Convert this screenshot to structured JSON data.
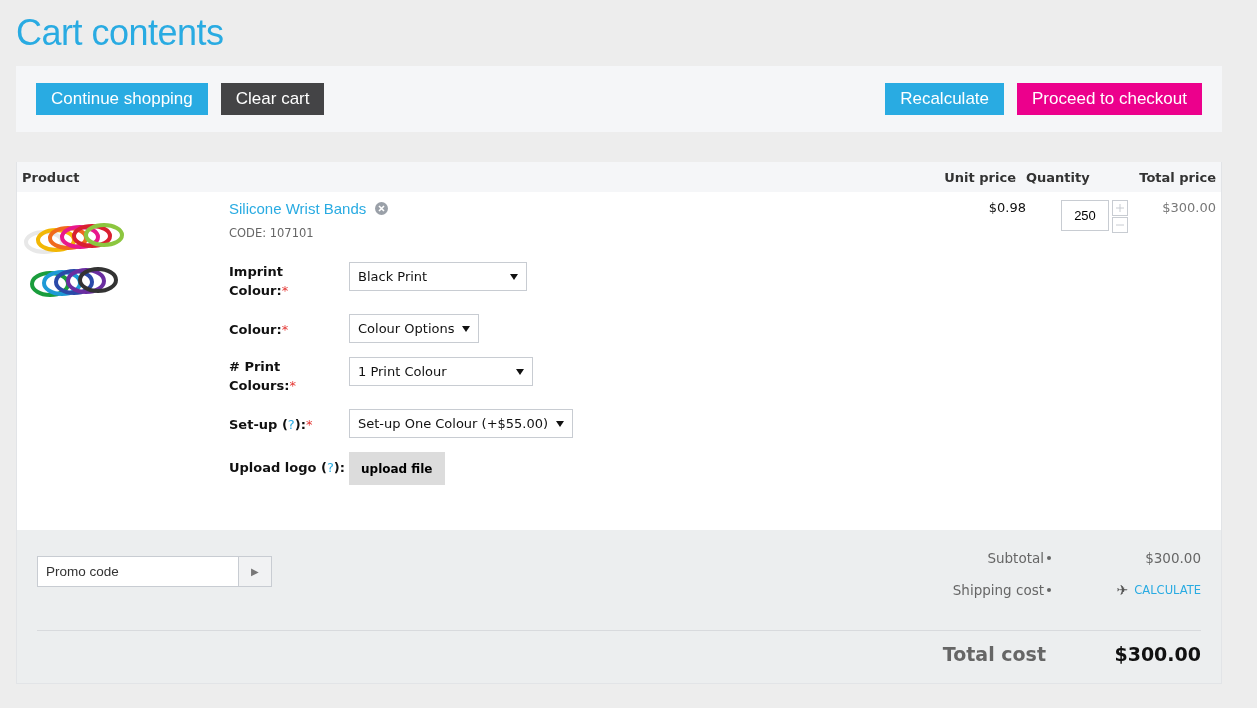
{
  "title": "Cart contents",
  "toolbar": {
    "left": [
      {
        "label": "Continue shopping",
        "kind": "primary"
      },
      {
        "label": "Clear cart",
        "kind": "dark"
      }
    ],
    "right": [
      {
        "label": "Recalculate",
        "kind": "primary"
      },
      {
        "label": "Proceed to checkout",
        "kind": "accent"
      }
    ]
  },
  "table": {
    "columns": [
      "Product",
      "Unit price",
      "Quantity",
      "Total price"
    ],
    "rows": [
      {
        "name": "Silicone Wrist Bands",
        "code": "CODE: 107101",
        "unit_price": "$0.98",
        "quantity": "250",
        "total_price": "$300.00",
        "options": [
          {
            "kind": "select",
            "label": "Imprint Colour:",
            "required": true,
            "value": "Black Print"
          },
          {
            "kind": "select",
            "label": "Colour:",
            "required": true,
            "value": "Colour Options"
          },
          {
            "kind": "select",
            "label": "# Print Colours:",
            "required": true,
            "value": "1 Print Colour"
          },
          {
            "kind": "select",
            "label": "Set-up (",
            "help": "?",
            "label_end": "):",
            "required": true,
            "value": "Set-up One Colour (+$55.00)"
          },
          {
            "kind": "upload",
            "label": "Upload logo (",
            "help": "?",
            "label_end": "):",
            "required": false,
            "value": "upload file"
          }
        ]
      }
    ]
  },
  "required_mark": "*",
  "summary": {
    "promo": {
      "placeholder": "Promo code",
      "button": "▶"
    },
    "subtotal": {
      "label": "Subtotal",
      "value": "$300.00"
    },
    "shipping": {
      "label": "Shipping cost",
      "icon": "✈",
      "link": "CALCULATE"
    },
    "total": {
      "label": "Total cost",
      "value": "$300.00"
    }
  }
}
